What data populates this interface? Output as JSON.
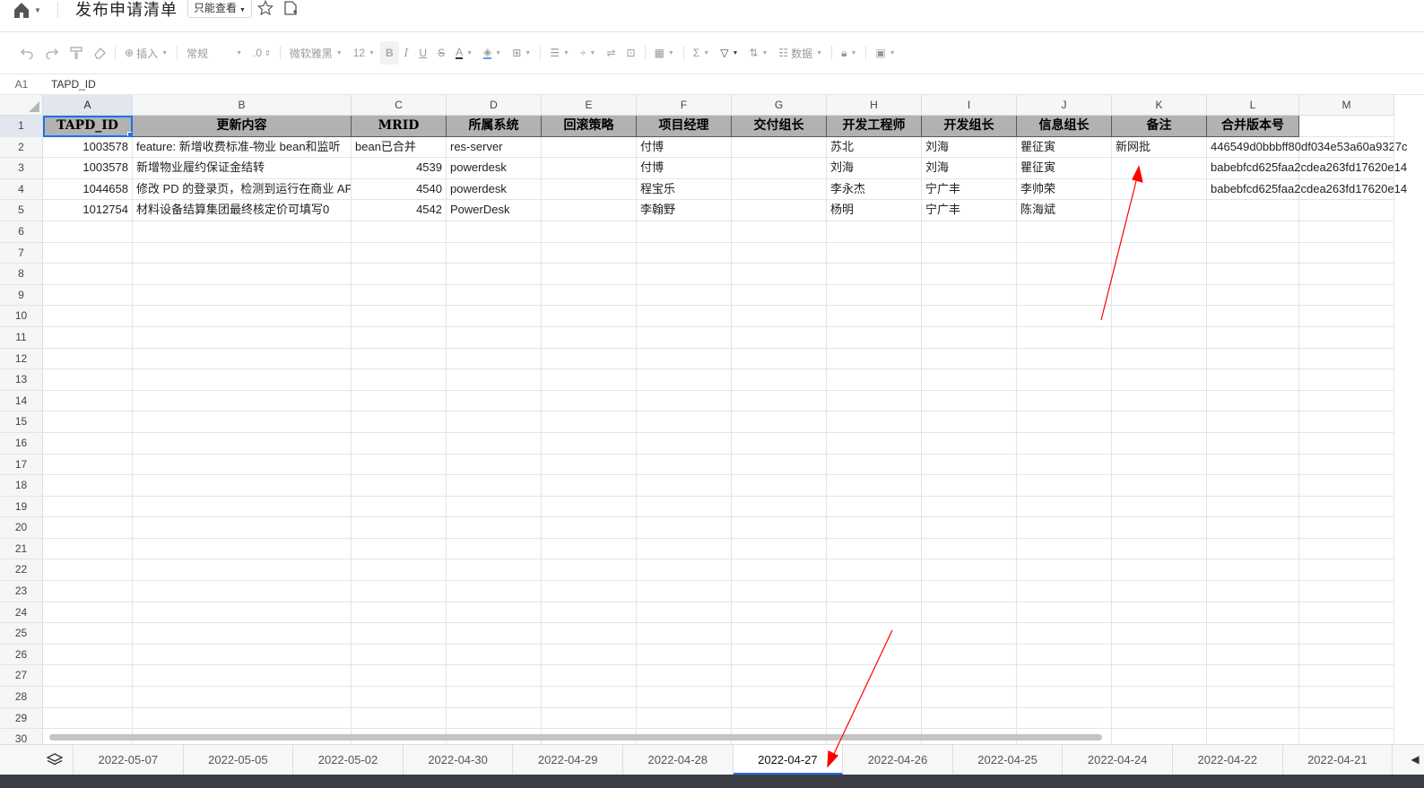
{
  "header": {
    "title": "发布申请清单",
    "mode_label": "只能查看"
  },
  "toolbar": {
    "insert_label": "插入",
    "format_label": "常规",
    "decimal_label": ".0",
    "font_label": "微软雅黑",
    "size_label": "12",
    "data_label": "数据"
  },
  "formula_bar": {
    "cell_ref": "A1",
    "content": "TAPD_ID"
  },
  "columns": [
    "A",
    "B",
    "C",
    "D",
    "E",
    "F",
    "G",
    "H",
    "I",
    "J",
    "K",
    "L",
    "M"
  ],
  "rows": [
    "1",
    "2",
    "3",
    "4",
    "5",
    "6",
    "7",
    "8",
    "9",
    "10",
    "11",
    "12",
    "13",
    "14",
    "15",
    "16",
    "17",
    "18",
    "19",
    "20",
    "21",
    "22",
    "23",
    "24",
    "25",
    "26",
    "27",
    "28",
    "29",
    "30"
  ],
  "table": {
    "headers": [
      "TAPD_ID",
      "更新内容",
      "MRID",
      "所属系统",
      "回滚策略",
      "项目经理",
      "交付组长",
      "开发工程师",
      "开发组长",
      "信息组长",
      "备注",
      "合并版本号"
    ],
    "data": [
      [
        "1003578",
        "feature: 新增收费标准-物业 bean和监听",
        "bean已合并",
        "res-server",
        "",
        "付博",
        "",
        "苏北",
        "刘海",
        "瞿征寅",
        "新网批",
        "446549d0bbbff80df034e53a60a9327c"
      ],
      [
        "1003578",
        "新增物业履约保证金结转",
        "4539",
        "powerdesk",
        "",
        "付博",
        "",
        "刘海",
        "刘海",
        "瞿征寅",
        "",
        "babebfcd625faa2cdea263fd17620e14"
      ],
      [
        "1044658",
        "修改 PD 的登录页，检测到运行在商业 API",
        "4540",
        "powerdesk",
        "",
        "程宝乐",
        "",
        "李永杰",
        "宁广丰",
        "李帅荣",
        "",
        "babebfcd625faa2cdea263fd17620e14"
      ],
      [
        "1012754",
        "材料设备结算集团最终核定价可填写0",
        "4542",
        "PowerDesk",
        "",
        "李翰野",
        "",
        "杨明",
        "宁广丰",
        "陈海斌",
        "",
        ""
      ]
    ]
  },
  "sheet_tabs": [
    "2022-05-07",
    "2022-05-05",
    "2022-05-02",
    "2022-04-30",
    "2022-04-29",
    "2022-04-28",
    "2022-04-27",
    "2022-04-26",
    "2022-04-25",
    "2022-04-24",
    "2022-04-22",
    "2022-04-21"
  ],
  "active_tab": "2022-04-27",
  "colors": {
    "accent": "#1a73e8",
    "header_fill": "#b2b2b2",
    "annotation": "#ff0000"
  },
  "icons": [
    "home-icon",
    "star-icon",
    "file-add-icon",
    "undo-icon",
    "redo-icon",
    "format-painter-icon",
    "eraser-icon",
    "layers-icon"
  ]
}
